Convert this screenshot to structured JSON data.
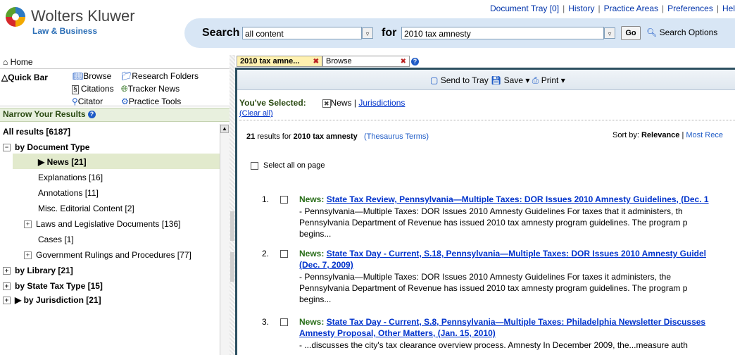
{
  "brand": {
    "name": "Wolters Kluwer",
    "sub": "Law & Business"
  },
  "toplinks": [
    "Document Tray [0]",
    "History",
    "Practice Areas",
    "Preferences",
    "Hel"
  ],
  "search": {
    "label": "Search",
    "scope_value": "all content",
    "for_label": "for",
    "query_value": "2010 tax amnesty",
    "go_label": "Go",
    "options_label": "Search Options"
  },
  "left": {
    "home": "Home",
    "quickbar_label": "Quick Bar",
    "quick_items": [
      "Browse",
      "Research Folders",
      "Citations",
      "Tracker News",
      "Citator",
      "Practice Tools"
    ],
    "narrow_title": "Narrow Your Results",
    "tree": {
      "all_results": "All results [6187]",
      "by_doc_type": "by Document Type",
      "news": "News [21]",
      "explanations": "Explanations [16]",
      "annotations": "Annotations [11]",
      "misc": "Misc. Editorial Content [2]",
      "laws": "Laws and Legislative Documents [136]",
      "cases": "Cases [1]",
      "gov": "Government Rulings and Procedures [77]",
      "by_library": "by Library [21]",
      "by_state_tax": "by State Tax Type [15]",
      "by_jurisdiction": "by Jurisdiction [21]"
    }
  },
  "tabs": [
    {
      "label": "2010 tax amne..."
    },
    {
      "label": "Browse"
    }
  ],
  "toolbar": {
    "send": "Send to Tray",
    "save": "Save",
    "print": "Print"
  },
  "selection": {
    "label": "You've Selected:",
    "news": "News",
    "jurisdictions": "Jurisdictions",
    "clear": "(Clear all)"
  },
  "results_header": {
    "count": "21",
    "for_text": "results for",
    "query": "2010 tax amnesty",
    "thesaurus": "(Thesaurus Terms)",
    "sort_label": "Sort by:",
    "sort_relevance": "Relevance",
    "sort_recent": "Most Rece"
  },
  "select_all": "Select all on page",
  "results": [
    {
      "num": "1.",
      "label": "News:",
      "title": "State Tax Review, Pennsylvania—Multiple Taxes: DOR Issues 2010 Amnesty Guidelines, (Dec. 1",
      "title2": "",
      "snippet": [
        "- Pennsylvania—Multiple Taxes: DOR Issues 2010 Amnesty Guidelines For taxes that it administers, th",
        "Pennsylvania Department of Revenue has issued 2010 tax amnesty program guidelines. The program p",
        "begins..."
      ]
    },
    {
      "num": "2.",
      "label": "News:",
      "title": "State Tax Day - Current, S.18, Pennsylvania—Multiple Taxes: DOR Issues 2010 Amnesty Guidel",
      "title2": "(Dec. 7, 2009)",
      "snippet": [
        "- Pennsylvania—Multiple Taxes: DOR Issues 2010 Amnesty Guidelines For taxes it administers, the",
        "Pennsylvania Department of Revenue has issued 2010 tax amnesty program guidelines. The program p",
        "begins..."
      ]
    },
    {
      "num": "3.",
      "label": "News:",
      "title": "State Tax Day - Current, S.8, Pennsylvania—Multiple Taxes: Philadelphia Newsletter Discusses",
      "title2": "Amnesty Proposal, Other Matters, (Jan. 15, 2010)",
      "snippet": [
        "- ...discusses the city's tax clearance overview process. Amnesty In December 2009, the...measure auth"
      ]
    }
  ],
  "colors": {
    "accent": "#2c4f60",
    "search_band": "#d8e6f5",
    "narrow_bg": "#e8f0de",
    "selected_row": "#e2eacd",
    "active_tab": "#fff1b0",
    "link": "#0033cc",
    "label_green": "#2a6e1a"
  }
}
